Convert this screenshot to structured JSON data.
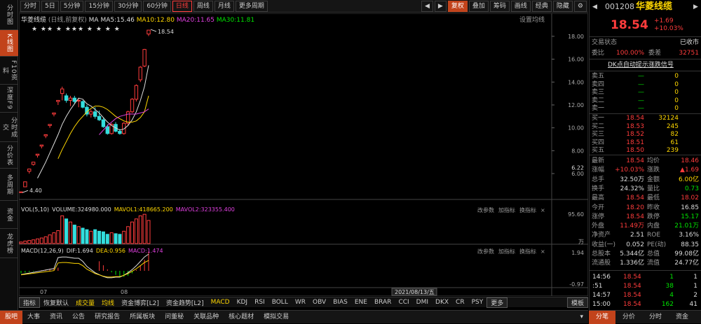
{
  "left_tabs": [
    {
      "label": "分时图"
    },
    {
      "label": "K线图",
      "active": true
    },
    {
      "label": "F10资料"
    },
    {
      "label": "深度F9"
    },
    {
      "label": "分时成交"
    },
    {
      "label": "分价表"
    },
    {
      "label": "多周期"
    },
    {
      "label": "资金"
    },
    {
      "label": "龙虎榜"
    }
  ],
  "toolbar": {
    "periods": [
      "分时",
      "5日",
      "5分钟",
      "15分钟",
      "30分钟",
      "60分钟",
      "日线",
      "周线",
      "月线",
      "更多周期"
    ],
    "selected": "日线",
    "right": [
      "复权",
      "叠加",
      "筹码",
      "画线",
      "经典",
      "隐藏"
    ],
    "arrows": [
      "◀",
      "▶"
    ],
    "gear": "⚙"
  },
  "chart": {
    "stock_name": "华菱线缆",
    "adj": "(日线,前复权)",
    "ma_label": "MA",
    "ma5": "MA5:15.46",
    "ma10": "MA10:12.80",
    "ma20": "MA20:11.65",
    "ma30": "MA30:11.81",
    "settings": "设置均线",
    "yticks": [
      "18.00",
      "16.00",
      "14.00",
      "12.00",
      "10.00",
      "8.00",
      "6.00"
    ],
    "current_price_tag": "6.22",
    "high_label": "18.54",
    "low_label": "4.40",
    "stars": "★ ★★ ★ ★★★ ★    ★  ★ ★",
    "xticks": [
      "07",
      "08"
    ],
    "date_label": "2021/08/13/五"
  },
  "chart_data": {
    "type": "candlestick",
    "candles": [
      {
        "o": 4.4,
        "h": 4.4,
        "l": 4.4,
        "c": 4.4
      },
      {
        "o": 4.84,
        "h": 5.28,
        "l": 4.84,
        "c": 5.28
      },
      {
        "o": 6.2,
        "h": 6.4,
        "l": 6.0,
        "c": 6.4
      },
      {
        "o": 6.8,
        "h": 7.0,
        "l": 6.7,
        "c": 7.0
      },
      {
        "o": 7.6,
        "h": 7.7,
        "l": 7.4,
        "c": 7.7
      },
      {
        "o": 8.4,
        "h": 8.5,
        "l": 8.2,
        "c": 8.5
      },
      {
        "o": 9.3,
        "h": 9.4,
        "l": 9.1,
        "c": 9.4
      },
      {
        "o": 10.2,
        "h": 10.3,
        "l": 10.0,
        "c": 10.3
      },
      {
        "o": 11.2,
        "h": 11.3,
        "l": 11.0,
        "c": 11.3
      },
      {
        "o": 12.3,
        "h": 12.4,
        "l": 12.0,
        "c": 12.4
      },
      {
        "o": 13.0,
        "h": 13.6,
        "l": 12.4,
        "c": 13.4
      },
      {
        "o": 12.8,
        "h": 13.0,
        "l": 12.2,
        "c": 12.4
      },
      {
        "o": 12.4,
        "h": 12.8,
        "l": 11.9,
        "c": 12.6
      },
      {
        "o": 12.6,
        "h": 12.8,
        "l": 12.1,
        "c": 12.3
      },
      {
        "o": 12.4,
        "h": 12.6,
        "l": 11.8,
        "c": 12.4
      },
      {
        "o": 12.3,
        "h": 12.4,
        "l": 11.7,
        "c": 11.8
      },
      {
        "o": 11.8,
        "h": 12.0,
        "l": 11.0,
        "c": 11.2
      },
      {
        "o": 11.2,
        "h": 11.6,
        "l": 10.9,
        "c": 11.4
      },
      {
        "o": 11.4,
        "h": 11.8,
        "l": 10.8,
        "c": 11.0
      },
      {
        "o": 11.0,
        "h": 11.5,
        "l": 10.6,
        "c": 10.7
      },
      {
        "o": 10.7,
        "h": 10.9,
        "l": 10.0,
        "c": 10.1
      },
      {
        "o": 10.1,
        "h": 10.3,
        "l": 9.4,
        "c": 9.5
      },
      {
        "o": 9.5,
        "h": 10.4,
        "l": 9.4,
        "c": 10.3
      },
      {
        "o": 10.3,
        "h": 10.5,
        "l": 9.6,
        "c": 9.7
      },
      {
        "o": 9.7,
        "h": 9.9,
        "l": 9.4,
        "c": 9.5
      },
      {
        "o": 9.5,
        "h": 10.5,
        "l": 9.4,
        "c": 10.4
      },
      {
        "o": 10.4,
        "h": 11.5,
        "l": 10.2,
        "c": 11.4
      },
      {
        "o": 11.4,
        "h": 12.6,
        "l": 11.3,
        "c": 12.5
      },
      {
        "o": 12.5,
        "h": 13.8,
        "l": 12.3,
        "c": 13.7
      },
      {
        "o": 14.2,
        "h": 15.4,
        "l": 14.0,
        "c": 15.3
      },
      {
        "o": 15.4,
        "h": 16.9,
        "l": 15.3,
        "c": 16.85
      },
      {
        "o": 18.2,
        "h": 18.54,
        "l": 18.02,
        "c": 18.54
      }
    ],
    "ma5": [
      null,
      null,
      null,
      null,
      5.6,
      6.3,
      7.0,
      7.8,
      8.6,
      9.4,
      10.3,
      11.0,
      11.6,
      12.1,
      12.6,
      12.5,
      12.1,
      11.9,
      11.6,
      11.3,
      10.9,
      10.5,
      10.2,
      10.0,
      9.8,
      9.9,
      10.2,
      10.7,
      11.4,
      12.4,
      13.6,
      15.46
    ],
    "ma10": [
      null,
      null,
      null,
      null,
      null,
      null,
      null,
      null,
      null,
      7.3,
      8.1,
      8.8,
      9.5,
      10.1,
      10.6,
      11.0,
      11.4,
      11.7,
      11.9,
      11.9,
      11.8,
      11.6,
      11.3,
      11.0,
      10.8,
      10.6,
      10.5,
      10.5,
      10.6,
      10.9,
      11.4,
      12.8
    ],
    "ma20": [
      null,
      null,
      null,
      null,
      null,
      null,
      null,
      null,
      null,
      null,
      null,
      null,
      null,
      null,
      null,
      null,
      null,
      null,
      null,
      9.4,
      9.8,
      10.2,
      10.5,
      10.8,
      11.0,
      11.1,
      11.2,
      11.2,
      11.2,
      11.3,
      11.4,
      11.65
    ],
    "vol": [
      5,
      8,
      10,
      12,
      15,
      18,
      22,
      28,
      35,
      42,
      90,
      80,
      70,
      60,
      55,
      50,
      45,
      40,
      45,
      40,
      38,
      30,
      35,
      32,
      30,
      40,
      55,
      70,
      80,
      90,
      95,
      75
    ],
    "macd": {
      "dif": "1.694",
      "dea": "0.956",
      "macd": "1.474"
    }
  },
  "vol_panel": {
    "title": "VOL(5,10)",
    "volume": "VOLUME:324980.000",
    "mavol1": "MAVOL1:418665.200",
    "mavol2": "MAVOL2:323355.400",
    "yticks": [
      "95.60",
      "万"
    ],
    "buttons": [
      "改参数",
      "加指标",
      "换指标"
    ]
  },
  "macd_panel": {
    "title": "MACD(12,26,9)",
    "dif": "DIF:1.694",
    "dea": "DEA:0.956",
    "macd": "MACD:1.474",
    "yticks": [
      "1.94",
      "-0.97"
    ],
    "buttons": [
      "改参数",
      "加指标",
      "换指标"
    ]
  },
  "indicator_bar": {
    "items": [
      "指标",
      "恢复默认",
      "成交量",
      "均线",
      "资金博弈[L2]",
      "资金趋势[L2]",
      "MACD",
      "KDJ",
      "RSI",
      "BOLL",
      "WR",
      "OBV",
      "BIAS",
      "ENE",
      "BRAR",
      "CCI",
      "DMI",
      "DKX",
      "CR",
      "PSY",
      "更多",
      "模板"
    ]
  },
  "nav_bar": {
    "items": [
      "股吧",
      "大事",
      "资讯",
      "公告",
      "研究报告",
      "所属板块",
      "问董秘",
      "关联品种",
      "核心题材",
      "模拟交易"
    ],
    "selected": "股吧"
  },
  "right": {
    "code": "001208",
    "name": "华菱线缆",
    "price": "18.54",
    "change": "+1.69",
    "change_pct": "+10.03%",
    "status_label": "交易状态",
    "status_value": "已收市",
    "weibi_label": "委比",
    "weibi_value": "100.00%",
    "weicha_label": "委差",
    "weicha_value": "32751",
    "link": "DK点自动提示涨跌信号",
    "sells": [
      {
        "label": "卖五",
        "price": "—",
        "vol": "0"
      },
      {
        "label": "卖四",
        "price": "—",
        "vol": "0"
      },
      {
        "label": "卖三",
        "price": "—",
        "vol": "0"
      },
      {
        "label": "卖二",
        "price": "—",
        "vol": "0"
      },
      {
        "label": "卖一",
        "price": "—",
        "vol": "0"
      }
    ],
    "buys": [
      {
        "label": "买一",
        "price": "18.54",
        "vol": "32124"
      },
      {
        "label": "买二",
        "price": "18.53",
        "vol": "245"
      },
      {
        "label": "买三",
        "price": "18.52",
        "vol": "82"
      },
      {
        "label": "买四",
        "price": "18.51",
        "vol": "61"
      },
      {
        "label": "买五",
        "price": "18.50",
        "vol": "239"
      }
    ],
    "stats": [
      [
        "最新",
        "18.54",
        "均价",
        "18.46"
      ],
      [
        "涨幅",
        "+10.03%",
        "涨跌",
        "▲1.69"
      ],
      [
        "总手",
        "32.50万",
        "金额",
        "6.00亿"
      ],
      [
        "换手",
        "24.32%",
        "量比",
        "0.73"
      ],
      [
        "最高",
        "18.54",
        "最低",
        "18.02"
      ],
      [
        "今开",
        "18.20",
        "昨收",
        "16.85"
      ],
      [
        "涨停",
        "18.54",
        "跌停",
        "15.17"
      ],
      [
        "外盘",
        "11.49万",
        "内盘",
        "21.01万"
      ],
      [
        "净资产",
        "2.51",
        "ROE",
        "3.16%"
      ],
      [
        "收益(一)",
        "0.052",
        "PE(动)",
        "88.35"
      ],
      [
        "总股本",
        "5.344亿",
        "总值",
        "99.08亿"
      ],
      [
        "流通股",
        "1.336亿",
        "流值",
        "24.77亿"
      ]
    ],
    "ticks": [
      {
        "time": "14:56",
        "price": "18.54",
        "vol": "1",
        "n": "1"
      },
      {
        "time": ":51",
        "price": "18.54",
        "vol": "38",
        "n": "1"
      },
      {
        "time": "14:57",
        "price": "18.54",
        "vol": "4",
        "n": "2"
      },
      {
        "time": "15:00",
        "price": "18.54",
        "vol": "162",
        "n": "41"
      }
    ],
    "tabs": [
      "分笔",
      "分价",
      "分时",
      "资金"
    ],
    "selected_tab": "分笔"
  }
}
